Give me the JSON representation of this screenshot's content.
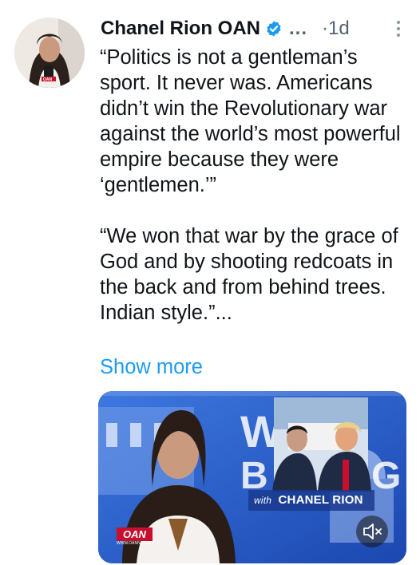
{
  "tweet": {
    "author_name": "Chanel Rion OAN",
    "overflow": "...",
    "separator": "·",
    "time": "1d",
    "paragraph1": "“Politics is not a gentleman’s sport. It never was. Americans didn’t win the Revolutionary war against the world’s most powerful empire because they were ‘gentlemen.’”",
    "paragraph2": "“We won that war by the grace of God and by shooting redcoats in the back and from behind trees. Indian style.”...",
    "show_more": "Show more"
  },
  "avatar": {
    "badge_text": "OAN"
  },
  "media": {
    "show_title_prefix": "with",
    "show_title_name": "CHANEL RION",
    "network_logo": "OAN",
    "network_url": "WWW.OANN.COM",
    "mute_icon": "speaker-muted-icon"
  },
  "colors": {
    "link": "#1d9bf0",
    "verified": "#1d9bf0",
    "meta": "#536471",
    "text": "#0f1419"
  }
}
